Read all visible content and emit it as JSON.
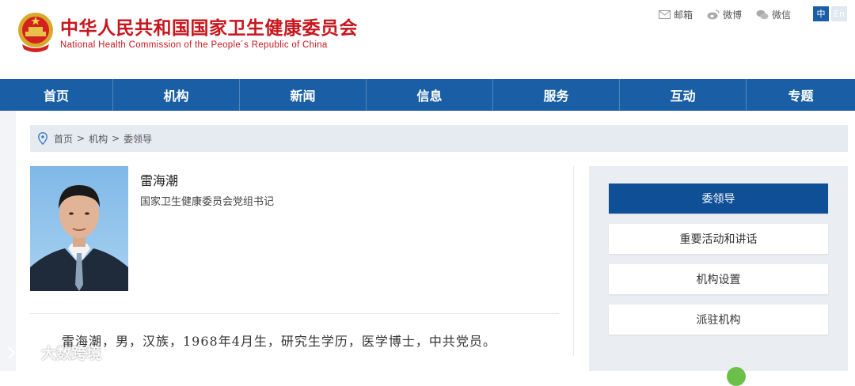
{
  "header": {
    "title_cn": "中华人民共和国国家卫生健康委员会",
    "title_en": "National Health Commission of the People´s Republic of China",
    "links": [
      {
        "label": "邮箱",
        "icon": "mail-icon"
      },
      {
        "label": "微博",
        "icon": "weibo-icon"
      },
      {
        "label": "微信",
        "icon": "wechat-icon"
      }
    ],
    "lang_cn": "中",
    "lang_en": "En"
  },
  "nav": {
    "items": [
      "首页",
      "机构",
      "新闻",
      "信息",
      "服务",
      "互动",
      "专题"
    ]
  },
  "breadcrumb": {
    "items": [
      "首页",
      "机构",
      "委领导"
    ],
    "separator": ">"
  },
  "profile": {
    "name": "雷海潮",
    "position": "国家卫生健康委员会党组书记",
    "bio": "雷海潮，男，汉族，1968年4月生，研究生学历，医学博士，中共党员。"
  },
  "sidebar": {
    "items": [
      "委领导",
      "重要活动和讲话",
      "机构设置",
      "派驻机构"
    ]
  },
  "watermark": "大数跨境",
  "colors": {
    "brand_red": "#c8161d",
    "nav_blue": "#1a5ea6",
    "active_blue": "#0e4f96"
  }
}
